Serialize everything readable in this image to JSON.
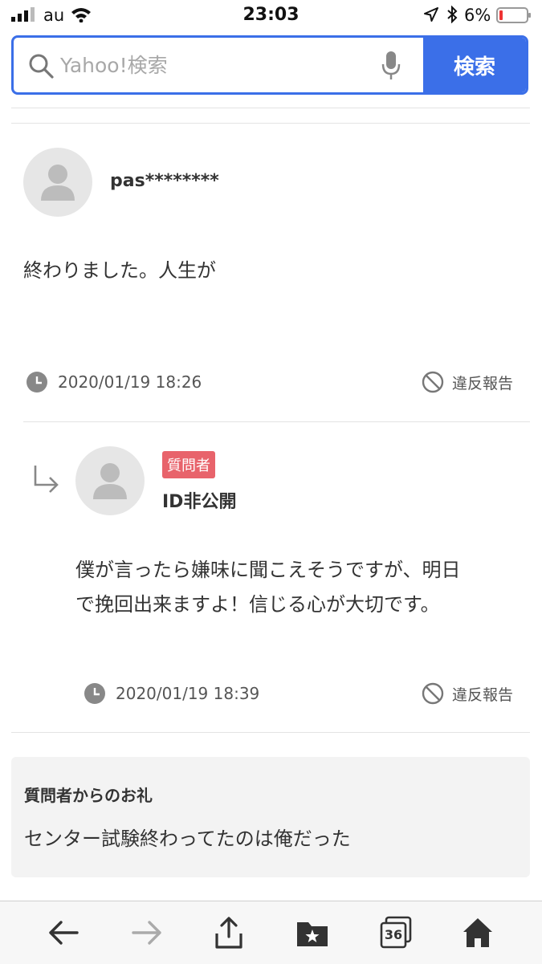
{
  "status_bar": {
    "carrier": "au",
    "time": "23:03",
    "battery_percent": "6%",
    "icons": [
      "signal-icon",
      "wifi-icon",
      "location-icon",
      "bluetooth-icon",
      "battery-icon"
    ]
  },
  "search": {
    "placeholder": "Yahoo!検索",
    "value": "",
    "button_label": "検索",
    "accent_color": "#3b6fe8"
  },
  "answer": {
    "username": "pas********",
    "text": "終わりました。人生が",
    "timestamp": "2020/01/19 18:26",
    "report_label": "違反報告"
  },
  "reply": {
    "badge": "質問者",
    "badge_color": "#e8636b",
    "username": "ID非公開",
    "text_line1": "僕が言ったら嫌味に聞こえそうですが、明日",
    "text_line2": "で挽回出来ますよ！信じる心が大切です。",
    "timestamp": "2020/01/19 18:39",
    "report_label": "違反報告"
  },
  "thanks": {
    "title": "質問者からのお礼",
    "text": "センター試験終わってたのは俺だった"
  },
  "bottom_bar": {
    "tabs_count": "36",
    "icons": [
      "back-arrow-icon",
      "forward-arrow-icon",
      "share-icon",
      "bookmarks-icon",
      "tabs-icon",
      "home-icon"
    ]
  }
}
